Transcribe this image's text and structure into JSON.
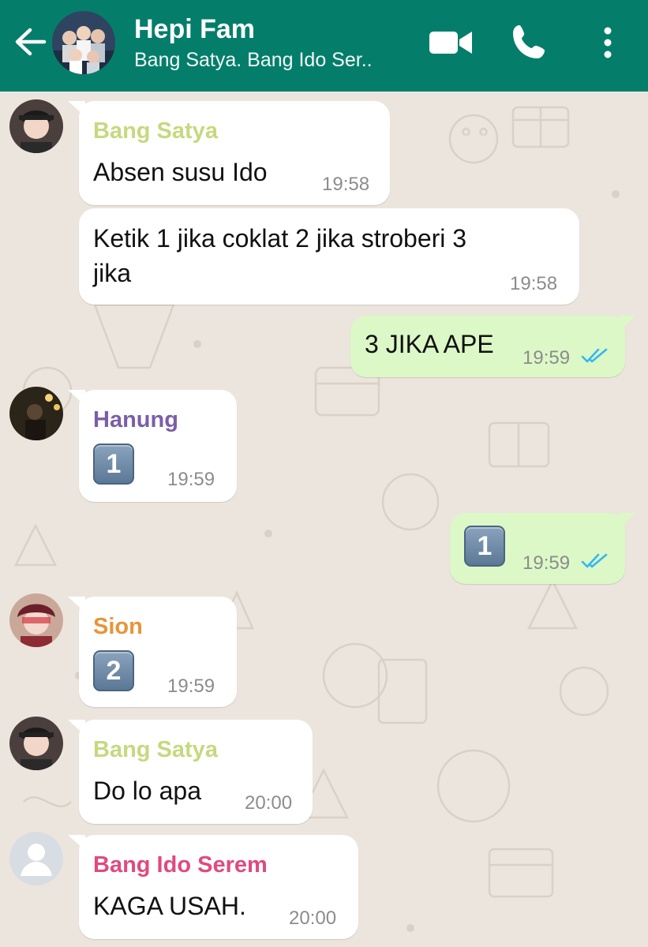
{
  "header": {
    "title": "Hepi Fam",
    "subtitle": "Bang Satya. Bang Ido Ser..",
    "icons": [
      "back-arrow-icon",
      "video-call-icon",
      "phone-icon",
      "more-vert-icon"
    ]
  },
  "colors": {
    "header_bg": "#047e6b",
    "incoming_bubble": "#ffffff",
    "outgoing_bubble": "#dcf8c6",
    "read_ticks": "#34b7f1",
    "sender_bang_satya": "#c5d97e",
    "sender_hanung": "#7b5ea7",
    "sender_sion": "#e8943a",
    "sender_bang_ido_serem": "#e04a7f"
  },
  "messages": [
    {
      "sender": "Bang Satya",
      "text": "Absen susu Ido",
      "time": "19:58"
    },
    {
      "text_line1": "Ketik 1 jika coklat 2 jika stroberi 3",
      "text_line2": "jika",
      "time": "19:58"
    },
    {
      "text": "3 JIKA APE",
      "time": "19:59"
    },
    {
      "sender": "Hanung",
      "emoji": "1",
      "time": "19:59"
    },
    {
      "emoji": "1",
      "time": "19:59"
    },
    {
      "sender": "Sion",
      "emoji": "2",
      "time": "19:59"
    },
    {
      "sender": "Bang Satya",
      "text": "Do lo apa",
      "time": "20:00"
    },
    {
      "sender": "Bang Ido Serem",
      "text": "KAGA USAH.",
      "time": "20:00"
    }
  ]
}
